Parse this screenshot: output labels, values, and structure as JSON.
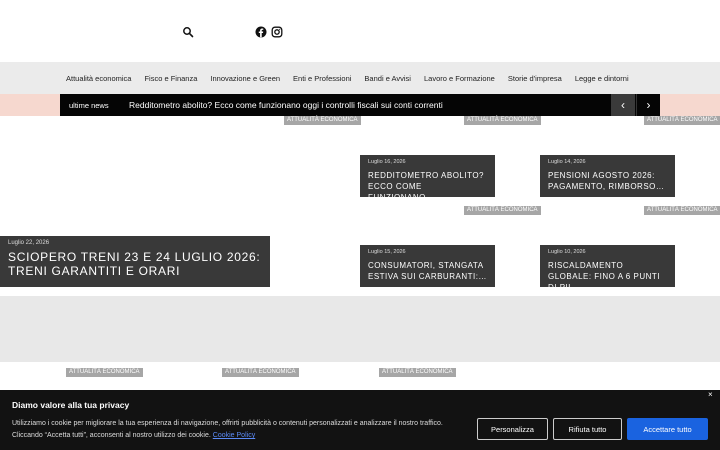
{
  "header": {
    "search_icon": "search-icon",
    "social": [
      "facebook-icon",
      "instagram-icon"
    ]
  },
  "nav": {
    "items": [
      "Attualità economica",
      "Fisco e Finanza",
      "Innovazione e Green",
      "Enti e Professioni",
      "Bandi e Avvisi",
      "Lavoro e Formazione",
      "Storie d'impresa",
      "Legge e dintorni"
    ]
  },
  "ticker": {
    "label": "ultime news",
    "text": "Redditometro abolito? Ecco come funzionano oggi i controlli fiscali sui conti correnti",
    "prev": "‹",
    "next": "›"
  },
  "category": "ATTUALITÀ ECONOMICA",
  "cards": [
    {
      "date": "Luglio 22, 2026",
      "title": "Sciopero treni 23 e 24 luglio 2026: treni garantiti e orari"
    },
    {
      "date": "Luglio 16, 2026",
      "title": "Redditometro abolito? Ecco come funzionano…"
    },
    {
      "date": "Luglio 14, 2026",
      "title": "Pensioni agosto 2026: pagamento, rimborso…"
    },
    {
      "date": "Luglio 15, 2026",
      "title": "Consumatori, stangata estiva sui carburanti:…"
    },
    {
      "date": "Luglio 10, 2026",
      "title": "Riscaldamento globale: fino a 6 punti di Pil…"
    }
  ],
  "cookie": {
    "title": "Diamo valore alla tua privacy",
    "text": "Utilizziamo i cookie per migliorare la tua esperienza di navigazione, offrirti pubblicità o contenuti personalizzati e analizzare il nostro traffico. Cliccando “Accetta tutti”, acconsenti al nostro utilizzo dei cookie.",
    "link": "Cookie Policy",
    "close": "×",
    "btn_personalizza": "Personalizza",
    "btn_rifiuta": "Rifiuta tutto",
    "btn_accetta": "Accettare tutto"
  },
  "colors": {
    "accent_blue": "#1a63e0",
    "ticker_band": "#f6d8cf",
    "nav_bg": "#ebebeb"
  }
}
